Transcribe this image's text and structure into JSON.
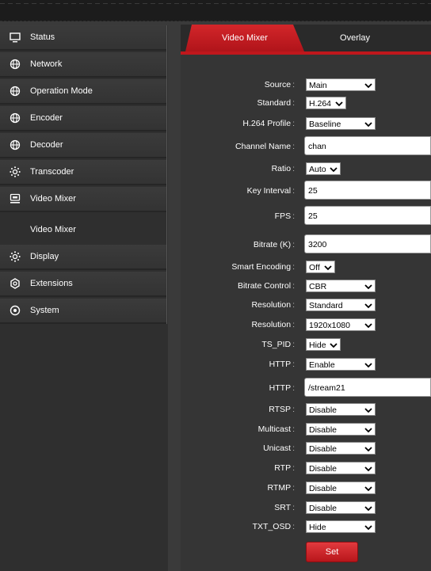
{
  "sidebar": {
    "items": [
      {
        "label": "Status",
        "icon": "monitor-icon"
      },
      {
        "label": "Network",
        "icon": "globe-icon"
      },
      {
        "label": "Operation Mode",
        "icon": "globe-icon"
      },
      {
        "label": "Encoder",
        "icon": "globe-icon"
      },
      {
        "label": "Decoder",
        "icon": "globe-icon"
      },
      {
        "label": "Transcoder",
        "icon": "gear-icon"
      },
      {
        "label": "Video Mixer",
        "icon": "mixer-icon"
      },
      {
        "label": "Display",
        "icon": "gear-icon"
      },
      {
        "label": "Extensions",
        "icon": "cog-icon"
      },
      {
        "label": "System",
        "icon": "target-icon"
      }
    ],
    "sub_item": "Video Mixer"
  },
  "tabs": [
    {
      "label": "Video Mixer",
      "active": true
    },
    {
      "label": "Overlay",
      "active": false
    }
  ],
  "form": {
    "source": {
      "label": "Source",
      "value": "Main"
    },
    "standard": {
      "label": "Standard",
      "value": "H.264"
    },
    "profile": {
      "label": "H.264 Profile",
      "value": "Baseline"
    },
    "channel_name": {
      "label": "Channel Name",
      "value": "chan"
    },
    "ratio": {
      "label": "Ratio",
      "value": "Auto"
    },
    "key_interval": {
      "label": "Key Interval",
      "value": "25"
    },
    "fps": {
      "label": "FPS",
      "value": "25"
    },
    "bitrate": {
      "label": "Bitrate (K)",
      "value": "3200"
    },
    "smart_encoding": {
      "label": "Smart Encoding",
      "value": "Off"
    },
    "bitrate_control": {
      "label": "Bitrate Control",
      "value": "CBR"
    },
    "resolution_mode": {
      "label": "Resolution",
      "value": "Standard"
    },
    "resolution": {
      "label": "Resolution",
      "value": "1920x1080"
    },
    "ts_pid": {
      "label": "TS_PID",
      "value": "Hide"
    },
    "http": {
      "label": "HTTP",
      "value": "Enable"
    },
    "http_path": {
      "label": "HTTP",
      "value": "/stream21"
    },
    "rtsp": {
      "label": "RTSP",
      "value": "Disable"
    },
    "multicast": {
      "label": "Multicast",
      "value": "Disable"
    },
    "unicast": {
      "label": "Unicast",
      "value": "Disable"
    },
    "rtp": {
      "label": "RTP",
      "value": "Disable"
    },
    "rtmp": {
      "label": "RTMP",
      "value": "Disable"
    },
    "srt": {
      "label": "SRT",
      "value": "Disable"
    },
    "txt_osd": {
      "label": "TXT_OSD",
      "value": "Hide"
    },
    "colon": ":"
  },
  "set_button": "Set",
  "colors": {
    "accent": "#c0171c",
    "sidebar": "#333333",
    "panel": "#353535"
  }
}
